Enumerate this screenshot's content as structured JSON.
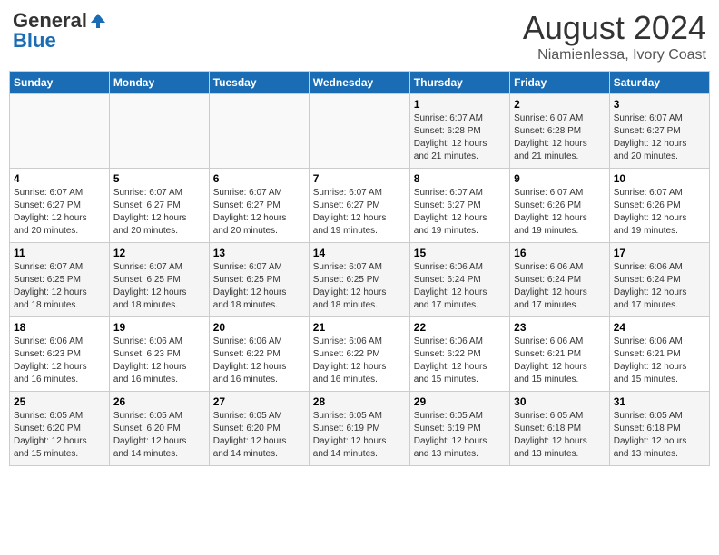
{
  "header": {
    "logo_line1": "General",
    "logo_line2": "Blue",
    "month": "August 2024",
    "location": "Niamienlessa, Ivory Coast"
  },
  "weekdays": [
    "Sunday",
    "Monday",
    "Tuesday",
    "Wednesday",
    "Thursday",
    "Friday",
    "Saturday"
  ],
  "weeks": [
    [
      {
        "day": "",
        "info": ""
      },
      {
        "day": "",
        "info": ""
      },
      {
        "day": "",
        "info": ""
      },
      {
        "day": "",
        "info": ""
      },
      {
        "day": "1",
        "info": "Sunrise: 6:07 AM\nSunset: 6:28 PM\nDaylight: 12 hours\nand 21 minutes."
      },
      {
        "day": "2",
        "info": "Sunrise: 6:07 AM\nSunset: 6:28 PM\nDaylight: 12 hours\nand 21 minutes."
      },
      {
        "day": "3",
        "info": "Sunrise: 6:07 AM\nSunset: 6:27 PM\nDaylight: 12 hours\nand 20 minutes."
      }
    ],
    [
      {
        "day": "4",
        "info": "Sunrise: 6:07 AM\nSunset: 6:27 PM\nDaylight: 12 hours\nand 20 minutes."
      },
      {
        "day": "5",
        "info": "Sunrise: 6:07 AM\nSunset: 6:27 PM\nDaylight: 12 hours\nand 20 minutes."
      },
      {
        "day": "6",
        "info": "Sunrise: 6:07 AM\nSunset: 6:27 PM\nDaylight: 12 hours\nand 20 minutes."
      },
      {
        "day": "7",
        "info": "Sunrise: 6:07 AM\nSunset: 6:27 PM\nDaylight: 12 hours\nand 19 minutes."
      },
      {
        "day": "8",
        "info": "Sunrise: 6:07 AM\nSunset: 6:27 PM\nDaylight: 12 hours\nand 19 minutes."
      },
      {
        "day": "9",
        "info": "Sunrise: 6:07 AM\nSunset: 6:26 PM\nDaylight: 12 hours\nand 19 minutes."
      },
      {
        "day": "10",
        "info": "Sunrise: 6:07 AM\nSunset: 6:26 PM\nDaylight: 12 hours\nand 19 minutes."
      }
    ],
    [
      {
        "day": "11",
        "info": "Sunrise: 6:07 AM\nSunset: 6:25 PM\nDaylight: 12 hours\nand 18 minutes."
      },
      {
        "day": "12",
        "info": "Sunrise: 6:07 AM\nSunset: 6:25 PM\nDaylight: 12 hours\nand 18 minutes."
      },
      {
        "day": "13",
        "info": "Sunrise: 6:07 AM\nSunset: 6:25 PM\nDaylight: 12 hours\nand 18 minutes."
      },
      {
        "day": "14",
        "info": "Sunrise: 6:07 AM\nSunset: 6:25 PM\nDaylight: 12 hours\nand 18 minutes."
      },
      {
        "day": "15",
        "info": "Sunrise: 6:06 AM\nSunset: 6:24 PM\nDaylight: 12 hours\nand 17 minutes."
      },
      {
        "day": "16",
        "info": "Sunrise: 6:06 AM\nSunset: 6:24 PM\nDaylight: 12 hours\nand 17 minutes."
      },
      {
        "day": "17",
        "info": "Sunrise: 6:06 AM\nSunset: 6:24 PM\nDaylight: 12 hours\nand 17 minutes."
      }
    ],
    [
      {
        "day": "18",
        "info": "Sunrise: 6:06 AM\nSunset: 6:23 PM\nDaylight: 12 hours\nand 16 minutes."
      },
      {
        "day": "19",
        "info": "Sunrise: 6:06 AM\nSunset: 6:23 PM\nDaylight: 12 hours\nand 16 minutes."
      },
      {
        "day": "20",
        "info": "Sunrise: 6:06 AM\nSunset: 6:22 PM\nDaylight: 12 hours\nand 16 minutes."
      },
      {
        "day": "21",
        "info": "Sunrise: 6:06 AM\nSunset: 6:22 PM\nDaylight: 12 hours\nand 16 minutes."
      },
      {
        "day": "22",
        "info": "Sunrise: 6:06 AM\nSunset: 6:22 PM\nDaylight: 12 hours\nand 15 minutes."
      },
      {
        "day": "23",
        "info": "Sunrise: 6:06 AM\nSunset: 6:21 PM\nDaylight: 12 hours\nand 15 minutes."
      },
      {
        "day": "24",
        "info": "Sunrise: 6:06 AM\nSunset: 6:21 PM\nDaylight: 12 hours\nand 15 minutes."
      }
    ],
    [
      {
        "day": "25",
        "info": "Sunrise: 6:05 AM\nSunset: 6:20 PM\nDaylight: 12 hours\nand 15 minutes."
      },
      {
        "day": "26",
        "info": "Sunrise: 6:05 AM\nSunset: 6:20 PM\nDaylight: 12 hours\nand 14 minutes."
      },
      {
        "day": "27",
        "info": "Sunrise: 6:05 AM\nSunset: 6:20 PM\nDaylight: 12 hours\nand 14 minutes."
      },
      {
        "day": "28",
        "info": "Sunrise: 6:05 AM\nSunset: 6:19 PM\nDaylight: 12 hours\nand 14 minutes."
      },
      {
        "day": "29",
        "info": "Sunrise: 6:05 AM\nSunset: 6:19 PM\nDaylight: 12 hours\nand 13 minutes."
      },
      {
        "day": "30",
        "info": "Sunrise: 6:05 AM\nSunset: 6:18 PM\nDaylight: 12 hours\nand 13 minutes."
      },
      {
        "day": "31",
        "info": "Sunrise: 6:05 AM\nSunset: 6:18 PM\nDaylight: 12 hours\nand 13 minutes."
      }
    ]
  ]
}
